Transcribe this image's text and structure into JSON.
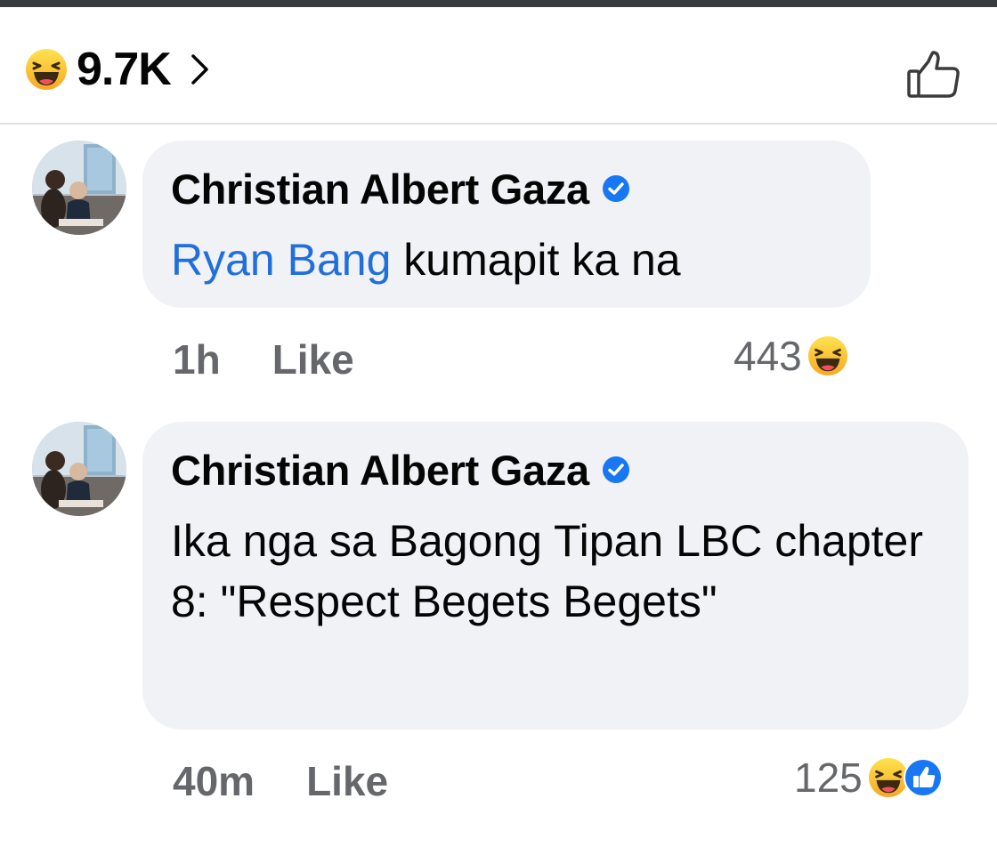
{
  "reactions": {
    "total": "9.7K",
    "primary_icon": "haha-icon",
    "like_button_icon": "thumbs-up-outline-icon"
  },
  "comments": [
    {
      "author": "Christian Albert Gaza",
      "verified": true,
      "mention": "Ryan Bang",
      "text": " kumapit ka na",
      "time": "1h",
      "like_label": "Like",
      "reaction_count": "443",
      "reaction_icons": [
        "haha-icon"
      ]
    },
    {
      "author": "Christian Albert Gaza",
      "verified": true,
      "text": "Ika nga sa Bagong Tipan LBC chapter 8: \"Respect Begets Begets\"",
      "time": "40m",
      "like_label": "Like",
      "reaction_count": "125",
      "reaction_icons": [
        "haha-icon",
        "like-icon"
      ]
    }
  ],
  "colors": {
    "mention": "#216fdb",
    "bubble": "#f0f2f5",
    "meta": "#65676b",
    "verified": "#1877f2",
    "haha": "#f7b125"
  }
}
